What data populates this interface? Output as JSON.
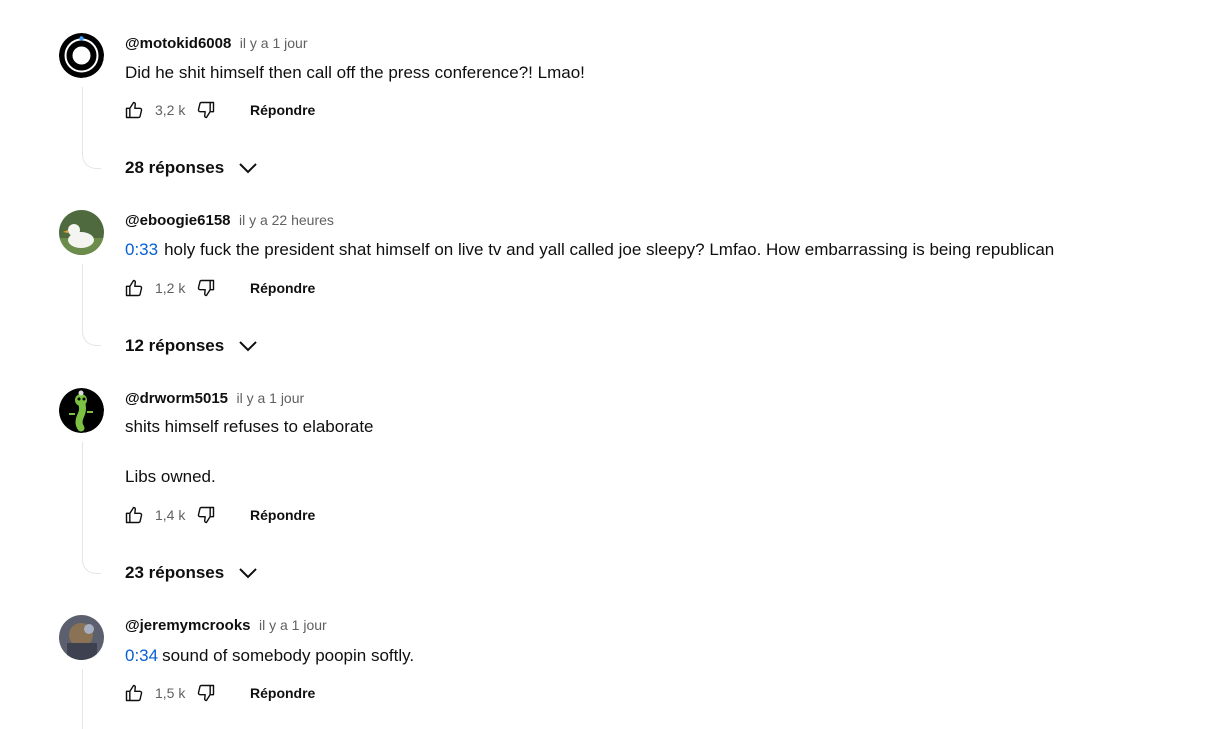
{
  "comments": [
    {
      "author": "@motokid6008",
      "time": "il y a 1 jour",
      "timestamp": "",
      "lines": [
        "Did he shit himself then call off the press conference?! Lmao!"
      ],
      "likes": "3,2 k",
      "reply_label": "Répondre",
      "replies_label": "28 réponses",
      "avatar_icon": "ring-logo-avatar"
    },
    {
      "author": "@eboogie6158",
      "time": "il y a 22 heures",
      "timestamp": "0:33",
      "lines": [
        "holy fuck the president shat himself on live tv and yall called joe sleepy? Lmfao. How embarrassing is being republican"
      ],
      "likes": "1,2 k",
      "reply_label": "Répondre",
      "replies_label": "12 réponses",
      "avatar_icon": "duck-avatar"
    },
    {
      "author": "@drworm5015",
      "time": "il y a 1 jour",
      "timestamp": "",
      "lines": [
        "shits himself refuses to elaborate",
        "Libs owned."
      ],
      "likes": "1,4 k",
      "reply_label": "Répondre",
      "replies_label": "23 réponses",
      "avatar_icon": "worm-doctor-avatar"
    },
    {
      "author": "@jeremymcrooks",
      "time": "il y a 1 jour",
      "timestamp": "0:34",
      "lines": [
        "sound of somebody poopin softly."
      ],
      "likes": "1,5 k",
      "reply_label": "Répondre",
      "replies_label": "",
      "avatar_icon": "photo-avatar"
    }
  ],
  "colors": {
    "timestamp_link": "#065fd4",
    "text_primary": "#0f0f0f",
    "text_secondary": "#606060",
    "thread_line": "#e5e5e5"
  }
}
